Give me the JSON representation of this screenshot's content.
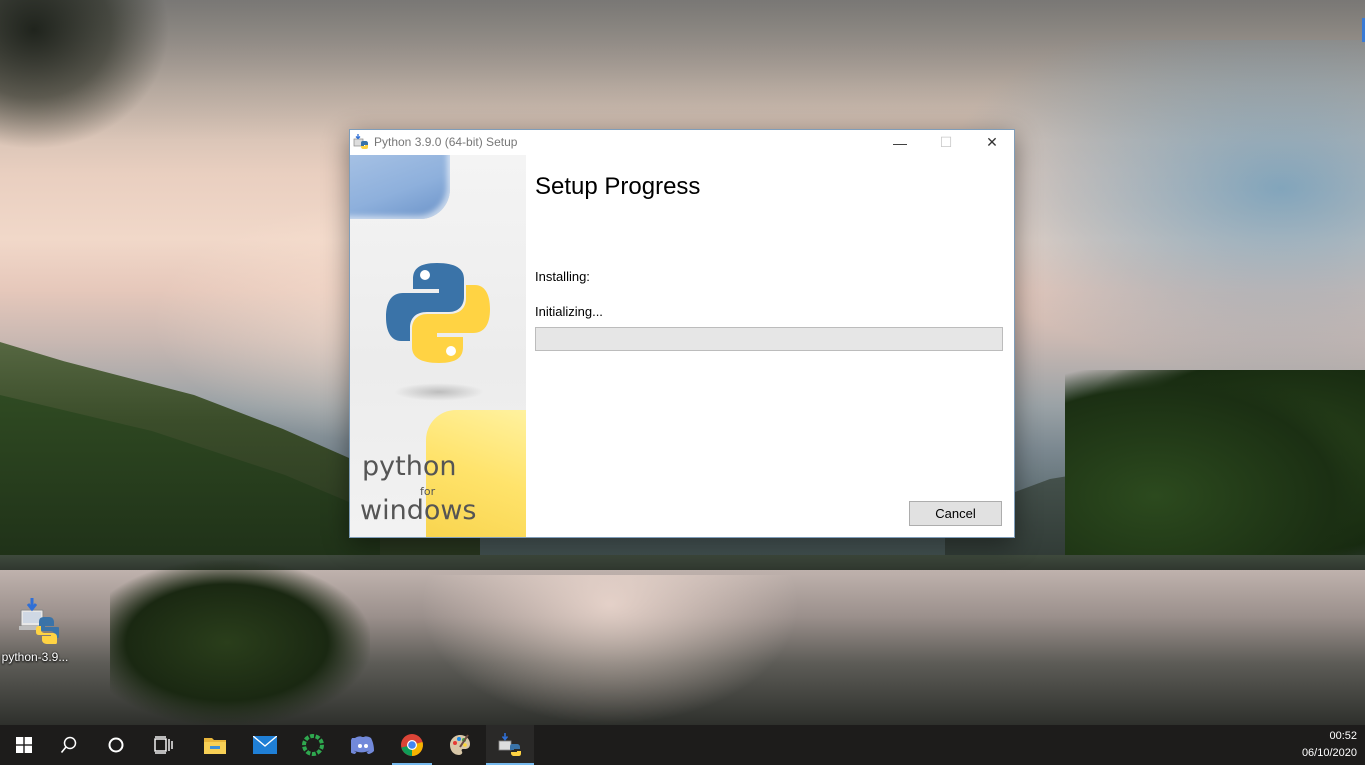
{
  "desktop": {
    "icon_label": "python-3.9..."
  },
  "window": {
    "title": "Python 3.9.0 (64-bit) Setup",
    "controls": {
      "minimize": "—",
      "maximize": "☐",
      "close": "✕"
    },
    "branding": {
      "line1": "python",
      "line2": "for",
      "line3": "windows"
    },
    "heading": "Setup Progress",
    "installing_label": "Installing:",
    "status_text": "Initializing...",
    "progress_fraction": 0,
    "cancel_label": "Cancel"
  },
  "taskbar": {
    "items": [
      {
        "name": "start-button",
        "icon": "windows-logo-icon"
      },
      {
        "name": "search-button",
        "icon": "search-icon"
      },
      {
        "name": "cortana-button",
        "icon": "circle-icon"
      },
      {
        "name": "task-view-button",
        "icon": "task-view-icon"
      },
      {
        "name": "file-explorer-button",
        "icon": "folder-icon"
      },
      {
        "name": "mail-button",
        "icon": "mail-icon"
      },
      {
        "name": "app-green-button",
        "icon": "green-ring-icon"
      },
      {
        "name": "discord-button",
        "icon": "discord-icon"
      },
      {
        "name": "chrome-button",
        "icon": "chrome-icon"
      },
      {
        "name": "paint-button",
        "icon": "paint-palette-icon"
      },
      {
        "name": "python-setup-button",
        "icon": "python-installer-icon"
      }
    ],
    "clock": {
      "time": "00:52",
      "date": "06/10/2020"
    }
  },
  "colors": {
    "taskbar": "#1d1c1b",
    "accent": "#76b9ed",
    "python_blue": "#3a73a8",
    "python_yellow": "#ffd343"
  }
}
